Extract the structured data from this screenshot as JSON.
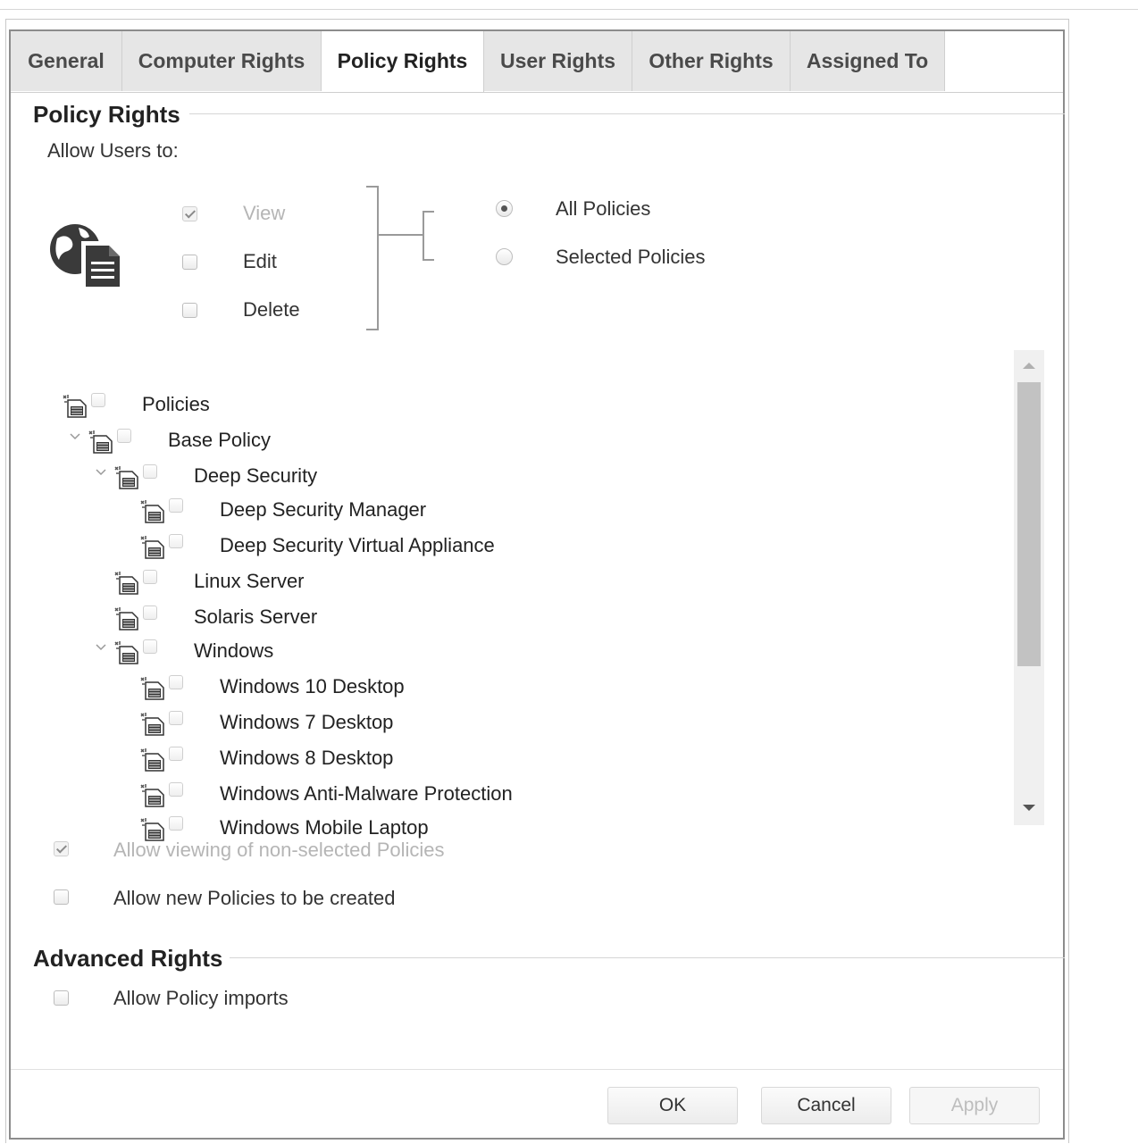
{
  "tabs": [
    {
      "label": "General",
      "active": false
    },
    {
      "label": "Computer Rights",
      "active": false
    },
    {
      "label": "Policy Rights",
      "active": true
    },
    {
      "label": "User Rights",
      "active": false
    },
    {
      "label": "Other Rights",
      "active": false
    },
    {
      "label": "Assigned To",
      "active": false
    }
  ],
  "policy_rights": {
    "title": "Policy Rights",
    "allow_users_to": "Allow Users to:",
    "icon": "globe-document-icon",
    "permissions": [
      {
        "label": "View",
        "checked": true,
        "disabled": true
      },
      {
        "label": "Edit",
        "checked": false,
        "disabled": false
      },
      {
        "label": "Delete",
        "checked": false,
        "disabled": false
      }
    ],
    "scope": [
      {
        "label": "All Policies",
        "selected": true
      },
      {
        "label": "Selected Policies",
        "selected": false
      }
    ],
    "tree": [
      {
        "label": "Policies",
        "depth": 0,
        "expanded": null
      },
      {
        "label": "Base Policy",
        "depth": 1,
        "expanded": true
      },
      {
        "label": "Deep Security",
        "depth": 2,
        "expanded": true
      },
      {
        "label": "Deep Security Manager",
        "depth": 3,
        "expanded": null
      },
      {
        "label": "Deep Security Virtual Appliance",
        "depth": 3,
        "expanded": null
      },
      {
        "label": "Linux Server",
        "depth": 2,
        "expanded": null
      },
      {
        "label": "Solaris Server",
        "depth": 2,
        "expanded": null
      },
      {
        "label": "Windows",
        "depth": 2,
        "expanded": true
      },
      {
        "label": "Windows 10 Desktop",
        "depth": 3,
        "expanded": null
      },
      {
        "label": "Windows 7 Desktop",
        "depth": 3,
        "expanded": null
      },
      {
        "label": "Windows 8 Desktop",
        "depth": 3,
        "expanded": null
      },
      {
        "label": "Windows Anti-Malware Protection",
        "depth": 3,
        "expanded": null
      },
      {
        "label": "Windows Mobile Laptop",
        "depth": 3,
        "expanded": null
      }
    ],
    "allow_viewing_non_selected": {
      "label": "Allow viewing of non-selected Policies",
      "checked": true,
      "disabled": true
    },
    "allow_new_policies": {
      "label": "Allow new Policies to be created",
      "checked": false,
      "disabled": false
    }
  },
  "advanced_rights": {
    "title": "Advanced Rights",
    "allow_policy_imports": {
      "label": "Allow Policy imports",
      "checked": false
    }
  },
  "buttons": {
    "ok": "OK",
    "cancel": "Cancel",
    "apply": "Apply"
  }
}
